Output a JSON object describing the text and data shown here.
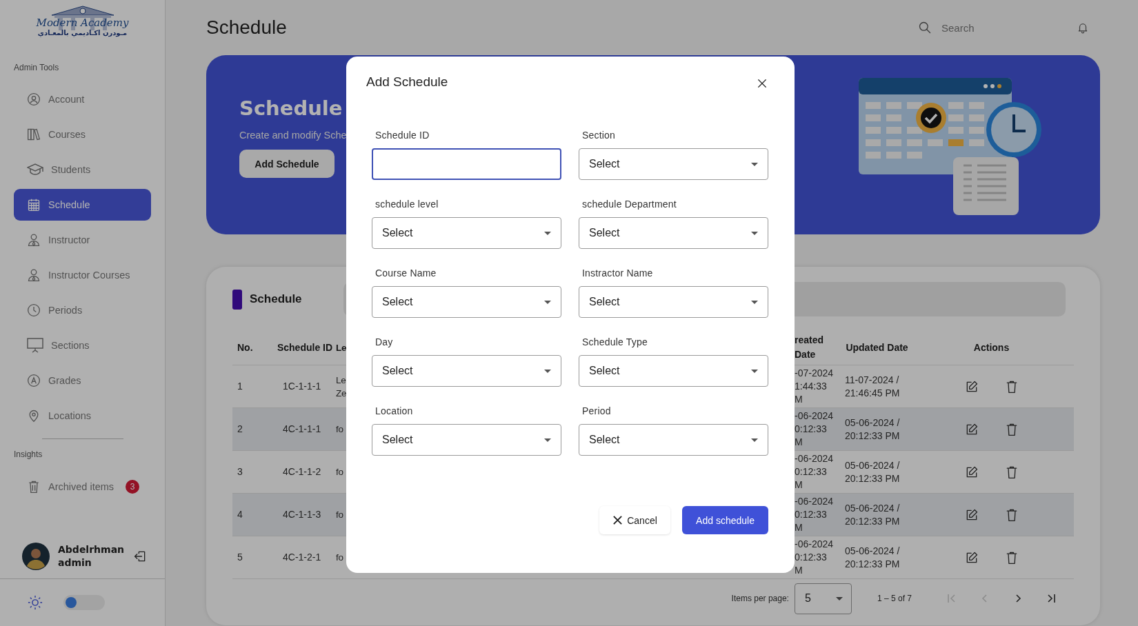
{
  "sidebar": {
    "logo": {
      "name": "Modern Academy",
      "subtitle": "مـودرن اكـاديمي بالمعـادي"
    },
    "sections": [
      {
        "title": "Admin Tools",
        "items": [
          {
            "label": "Account",
            "kind": "user",
            "selected": false
          },
          {
            "label": "Courses",
            "kind": "books",
            "selected": false
          },
          {
            "label": "Students",
            "kind": "cap",
            "selected": false
          },
          {
            "label": "Schedule",
            "kind": "calendar",
            "selected": true
          },
          {
            "label": "Instructor",
            "kind": "person",
            "selected": false
          },
          {
            "label": "Instructor Courses",
            "kind": "person",
            "selected": false
          },
          {
            "label": "Periods",
            "kind": "clock",
            "selected": false
          },
          {
            "label": "Sections",
            "kind": "board",
            "selected": false
          },
          {
            "label": "Grades",
            "kind": "grade",
            "selected": false
          },
          {
            "label": "Locations",
            "kind": "pin",
            "selected": false
          }
        ]
      },
      {
        "title": "Insights",
        "items": [
          {
            "label": "Archived items",
            "kind": "trash",
            "badge": "3",
            "selected": false
          }
        ]
      }
    ],
    "user": {
      "name": "Abdelrhman",
      "role": "admin"
    },
    "dark_mode": false
  },
  "header": {
    "title": "Schedule",
    "search": {
      "placeholder": "Search"
    }
  },
  "banner": {
    "title": "Schedule",
    "subtitle": "Create and modify Sche",
    "button": "Add Schedule"
  },
  "table_card": {
    "title": "Schedule",
    "columns": [
      "No.",
      "Schedule ID",
      "Le",
      "reated Date",
      "Updated Date",
      "Actions"
    ],
    "rows": [
      {
        "cells": [
          "1",
          "1C-1-1-1",
          "Le\nZe",
          "-07-2024\n1:44:33\nM",
          "11-07-2024 / 21:46:45 PM"
        ]
      },
      {
        "cells": [
          "2",
          "4C-1-1-1",
          "fo",
          "-06-2024\n0:12:33\nM",
          "05-06-2024 / 20:12:33 PM"
        ]
      },
      {
        "cells": [
          "3",
          "4C-1-1-2",
          "fo",
          "-06-2024\n0:12:33\nM",
          "05-06-2024 / 20:12:33 PM"
        ]
      },
      {
        "cells": [
          "4",
          "4C-1-1-3",
          "fo",
          "-06-2024\n0:12:33\nM",
          "05-06-2024 / 20:12:33 PM"
        ]
      },
      {
        "cells": [
          "5",
          "4C-1-2-1",
          "fo",
          "-06-2024\n0:12:33\nM",
          "05-06-2024 / 20:12:33 PM"
        ]
      }
    ],
    "pagination": {
      "label": "Items per page:",
      "page_size": "5",
      "range": "1 – 5 of 7",
      "buttons": [
        {
          "kind": "first",
          "disabled": true
        },
        {
          "kind": "prev",
          "disabled": true
        },
        {
          "kind": "next",
          "disabled": false
        },
        {
          "kind": "last",
          "disabled": false
        }
      ]
    }
  },
  "dialog": {
    "title": "Add Schedule",
    "fields": [
      {
        "label": "Schedule ID",
        "kind": "text",
        "focused": true
      },
      {
        "label": "Section",
        "kind": "select",
        "value": "Select",
        "focused": false
      },
      {
        "label": "schedule level",
        "kind": "select",
        "value": "Select",
        "focused": false
      },
      {
        "label": "schedule Department",
        "kind": "select",
        "value": "Select",
        "focused": false
      },
      {
        "label": "Course Name",
        "kind": "select",
        "value": "Select",
        "focused": false
      },
      {
        "label": "Instractor Name",
        "kind": "select",
        "value": "Select",
        "focused": false
      },
      {
        "label": "Day",
        "kind": "select",
        "value": "Select",
        "focused": false
      },
      {
        "label": "Schedule Type",
        "kind": "select",
        "value": "Select",
        "focused": false
      },
      {
        "label": "Location",
        "kind": "select",
        "value": "Select",
        "focused": false
      },
      {
        "label": "Period",
        "kind": "select",
        "value": "Select",
        "focused": false
      }
    ],
    "cancel": "Cancel",
    "submit": "Add schedule"
  }
}
